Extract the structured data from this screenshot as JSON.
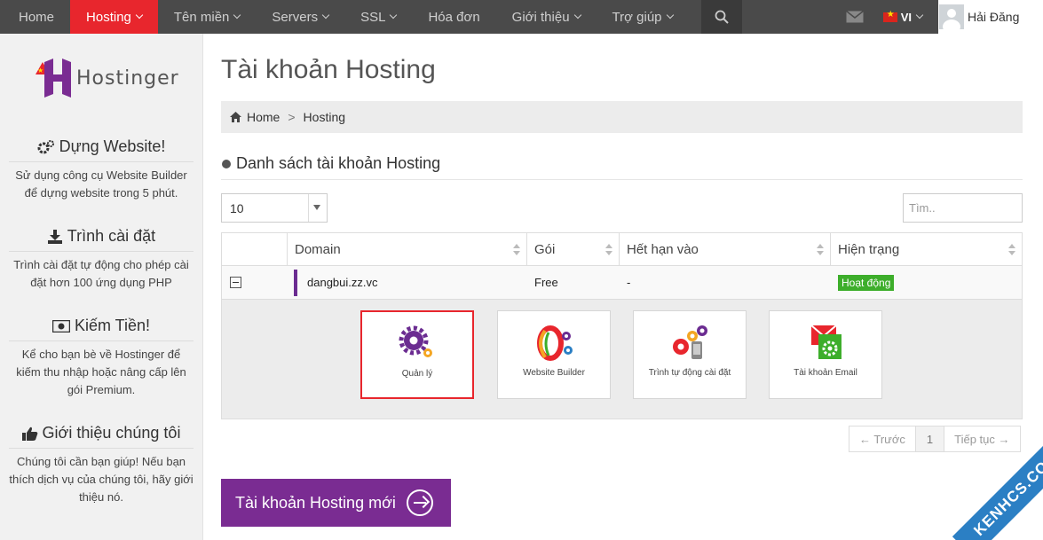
{
  "nav": {
    "items": [
      {
        "label": "Home"
      },
      {
        "label": "Hosting"
      },
      {
        "label": "Tên miền"
      },
      {
        "label": "Servers"
      },
      {
        "label": "SSL"
      },
      {
        "label": "Hóa đơn"
      },
      {
        "label": "Giới thiệu"
      },
      {
        "label": "Trợ giúp"
      }
    ],
    "lang": "VI",
    "user_name": "Hải Đăng"
  },
  "sidebar": {
    "logo_text": "Hostinger",
    "blocks": [
      {
        "title": "Dựng Website!",
        "text": "Sử dụng công cụ Website Builder để dựng website trong 5 phút."
      },
      {
        "title": "Trình cài đặt",
        "text": "Trình cài đặt tự động cho phép cài đặt hơn 100 ứng dụng PHP"
      },
      {
        "title": "Kiếm Tiền!",
        "text": "Kể cho bạn bè về Hostinger để kiếm thu nhập hoặc nâng cấp lên gói Premium."
      },
      {
        "title": "Giới thiệu chúng tôi",
        "text": "Chúng tôi cần bạn giúp! Nếu bạn thích dịch vụ của chúng tôi, hãy giới thiệu nó."
      }
    ]
  },
  "page": {
    "title": "Tài khoản Hosting",
    "breadcrumb": [
      "Home",
      "Hosting"
    ],
    "section_title": "Danh sách tài khoản Hosting",
    "length_value": "10",
    "search_placeholder": "Tìm.."
  },
  "table": {
    "columns": [
      "Domain",
      "Gói",
      "Hết hạn vào",
      "Hiện trạng"
    ],
    "rows": [
      {
        "domain": "dangbui.zz.vc",
        "plan": "Free",
        "expires": "-",
        "status": "Hoạt động"
      }
    ],
    "tiles": [
      {
        "label": "Quản lý"
      },
      {
        "label": "Website Builder"
      },
      {
        "label": "Trình tự động cài đặt"
      },
      {
        "label": "Tài khoản Email"
      }
    ]
  },
  "pagination": {
    "prev": "← Trước",
    "current": "1",
    "next": "Tiếp tục →"
  },
  "new_button": {
    "label": "Tài khoản Hosting mới"
  },
  "watermark": "KENHCS.COM",
  "colors": {
    "nav_bg": "#4a4a4a",
    "nav_active": "#e8262d",
    "brand_purple": "#7a2c92",
    "status_green": "#3dae2b",
    "sidebar_bg": "#f1f1f1"
  }
}
